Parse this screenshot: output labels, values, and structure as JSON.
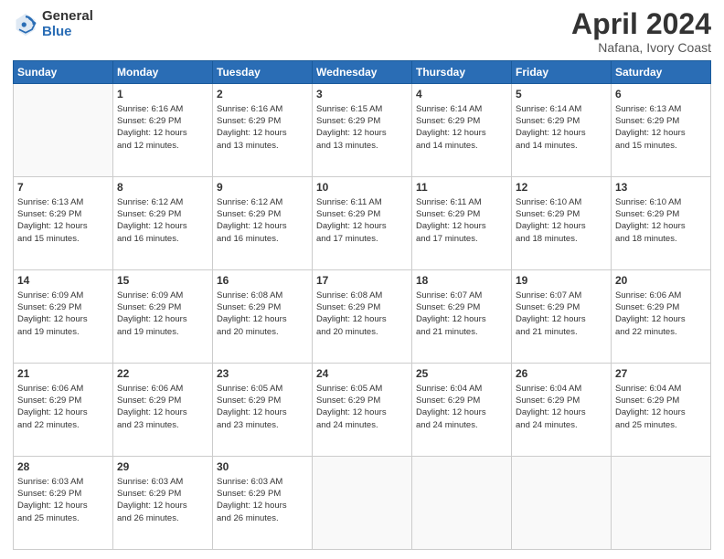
{
  "logo": {
    "general": "General",
    "blue": "Blue"
  },
  "header": {
    "title": "April 2024",
    "subtitle": "Nafana, Ivory Coast"
  },
  "weekdays": [
    "Sunday",
    "Monday",
    "Tuesday",
    "Wednesday",
    "Thursday",
    "Friday",
    "Saturday"
  ],
  "weeks": [
    [
      {
        "day": "",
        "info": ""
      },
      {
        "day": "1",
        "info": "Sunrise: 6:16 AM\nSunset: 6:29 PM\nDaylight: 12 hours\nand 12 minutes."
      },
      {
        "day": "2",
        "info": "Sunrise: 6:16 AM\nSunset: 6:29 PM\nDaylight: 12 hours\nand 13 minutes."
      },
      {
        "day": "3",
        "info": "Sunrise: 6:15 AM\nSunset: 6:29 PM\nDaylight: 12 hours\nand 13 minutes."
      },
      {
        "day": "4",
        "info": "Sunrise: 6:14 AM\nSunset: 6:29 PM\nDaylight: 12 hours\nand 14 minutes."
      },
      {
        "day": "5",
        "info": "Sunrise: 6:14 AM\nSunset: 6:29 PM\nDaylight: 12 hours\nand 14 minutes."
      },
      {
        "day": "6",
        "info": "Sunrise: 6:13 AM\nSunset: 6:29 PM\nDaylight: 12 hours\nand 15 minutes."
      }
    ],
    [
      {
        "day": "7",
        "info": "Sunrise: 6:13 AM\nSunset: 6:29 PM\nDaylight: 12 hours\nand 15 minutes."
      },
      {
        "day": "8",
        "info": "Sunrise: 6:12 AM\nSunset: 6:29 PM\nDaylight: 12 hours\nand 16 minutes."
      },
      {
        "day": "9",
        "info": "Sunrise: 6:12 AM\nSunset: 6:29 PM\nDaylight: 12 hours\nand 16 minutes."
      },
      {
        "day": "10",
        "info": "Sunrise: 6:11 AM\nSunset: 6:29 PM\nDaylight: 12 hours\nand 17 minutes."
      },
      {
        "day": "11",
        "info": "Sunrise: 6:11 AM\nSunset: 6:29 PM\nDaylight: 12 hours\nand 17 minutes."
      },
      {
        "day": "12",
        "info": "Sunrise: 6:10 AM\nSunset: 6:29 PM\nDaylight: 12 hours\nand 18 minutes."
      },
      {
        "day": "13",
        "info": "Sunrise: 6:10 AM\nSunset: 6:29 PM\nDaylight: 12 hours\nand 18 minutes."
      }
    ],
    [
      {
        "day": "14",
        "info": "Sunrise: 6:09 AM\nSunset: 6:29 PM\nDaylight: 12 hours\nand 19 minutes."
      },
      {
        "day": "15",
        "info": "Sunrise: 6:09 AM\nSunset: 6:29 PM\nDaylight: 12 hours\nand 19 minutes."
      },
      {
        "day": "16",
        "info": "Sunrise: 6:08 AM\nSunset: 6:29 PM\nDaylight: 12 hours\nand 20 minutes."
      },
      {
        "day": "17",
        "info": "Sunrise: 6:08 AM\nSunset: 6:29 PM\nDaylight: 12 hours\nand 20 minutes."
      },
      {
        "day": "18",
        "info": "Sunrise: 6:07 AM\nSunset: 6:29 PM\nDaylight: 12 hours\nand 21 minutes."
      },
      {
        "day": "19",
        "info": "Sunrise: 6:07 AM\nSunset: 6:29 PM\nDaylight: 12 hours\nand 21 minutes."
      },
      {
        "day": "20",
        "info": "Sunrise: 6:06 AM\nSunset: 6:29 PM\nDaylight: 12 hours\nand 22 minutes."
      }
    ],
    [
      {
        "day": "21",
        "info": "Sunrise: 6:06 AM\nSunset: 6:29 PM\nDaylight: 12 hours\nand 22 minutes."
      },
      {
        "day": "22",
        "info": "Sunrise: 6:06 AM\nSunset: 6:29 PM\nDaylight: 12 hours\nand 23 minutes."
      },
      {
        "day": "23",
        "info": "Sunrise: 6:05 AM\nSunset: 6:29 PM\nDaylight: 12 hours\nand 23 minutes."
      },
      {
        "day": "24",
        "info": "Sunrise: 6:05 AM\nSunset: 6:29 PM\nDaylight: 12 hours\nand 24 minutes."
      },
      {
        "day": "25",
        "info": "Sunrise: 6:04 AM\nSunset: 6:29 PM\nDaylight: 12 hours\nand 24 minutes."
      },
      {
        "day": "26",
        "info": "Sunrise: 6:04 AM\nSunset: 6:29 PM\nDaylight: 12 hours\nand 24 minutes."
      },
      {
        "day": "27",
        "info": "Sunrise: 6:04 AM\nSunset: 6:29 PM\nDaylight: 12 hours\nand 25 minutes."
      }
    ],
    [
      {
        "day": "28",
        "info": "Sunrise: 6:03 AM\nSunset: 6:29 PM\nDaylight: 12 hours\nand 25 minutes."
      },
      {
        "day": "29",
        "info": "Sunrise: 6:03 AM\nSunset: 6:29 PM\nDaylight: 12 hours\nand 26 minutes."
      },
      {
        "day": "30",
        "info": "Sunrise: 6:03 AM\nSunset: 6:29 PM\nDaylight: 12 hours\nand 26 minutes."
      },
      {
        "day": "",
        "info": ""
      },
      {
        "day": "",
        "info": ""
      },
      {
        "day": "",
        "info": ""
      },
      {
        "day": "",
        "info": ""
      }
    ]
  ]
}
